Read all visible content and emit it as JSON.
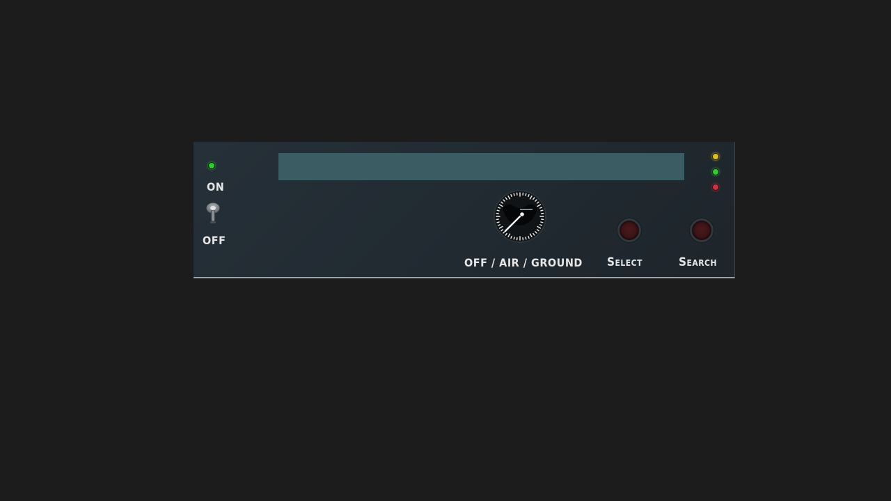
{
  "power": {
    "on_label": "ON",
    "off_label": "OFF",
    "led_color": "#2ecc2e",
    "switch_state": "off"
  },
  "display": {
    "text": "",
    "color": "#3b5c63"
  },
  "mode_selector": {
    "label": "OFF / AIR / GROUND",
    "icon": "rotary-knob-icon"
  },
  "buttons": {
    "select_label": "Select",
    "search_label": "Search"
  },
  "status_leds": [
    {
      "name": "yellow",
      "color": "#e0c020"
    },
    {
      "name": "green",
      "color": "#2ecc2e"
    },
    {
      "name": "red",
      "color": "#d03040"
    }
  ]
}
